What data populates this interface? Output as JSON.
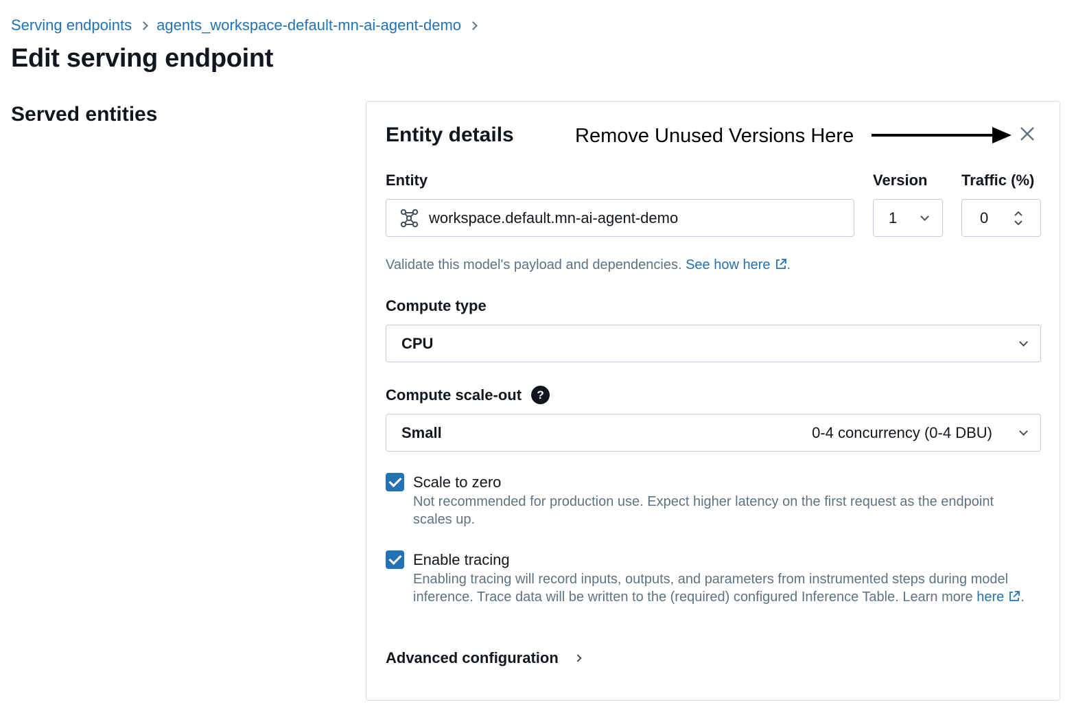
{
  "breadcrumb": {
    "root": "Serving endpoints",
    "current": "agents_workspace-default-mn-ai-agent-demo"
  },
  "page_title": "Edit serving endpoint",
  "section_title": "Served entities",
  "card": {
    "title": "Entity details",
    "annotation": "Remove Unused Versions Here",
    "entity_label": "Entity",
    "entity_value": "workspace.default.mn-ai-agent-demo",
    "version_label": "Version",
    "version_value": "1",
    "traffic_label": "Traffic (%)",
    "traffic_value": "0",
    "validate_text": "Validate this model's payload and dependencies.",
    "validate_link": "See how here",
    "validate_end": ".",
    "compute_type_label": "Compute type",
    "compute_type_value": "CPU",
    "scaleout_label": "Compute scale-out",
    "help_glyph": "?",
    "scaleout_value": "Small",
    "scaleout_detail": "0-4 concurrency (0-4 DBU)",
    "scale_to_zero_label": "Scale to zero",
    "scale_to_zero_desc": "Not recommended for production use. Expect higher latency on the first request as the endpoint scales up.",
    "tracing_label": "Enable tracing",
    "tracing_desc": "Enabling tracing will record inputs, outputs, and parameters from instrumented steps during model inference. Trace data will be written to the (required) configured Inference Table.",
    "tracing_learn": "Learn more",
    "tracing_link": "here",
    "tracing_end": ".",
    "advanced_label": "Advanced configuration"
  },
  "icons": {
    "close": "close-icon",
    "entity": "model-graph-icon",
    "external": "external-link-icon",
    "help": "question-circle-icon"
  },
  "colors": {
    "link": "#2272b4",
    "checkbox": "#2272b4",
    "text": "#11171c",
    "muted": "#5f7281"
  }
}
